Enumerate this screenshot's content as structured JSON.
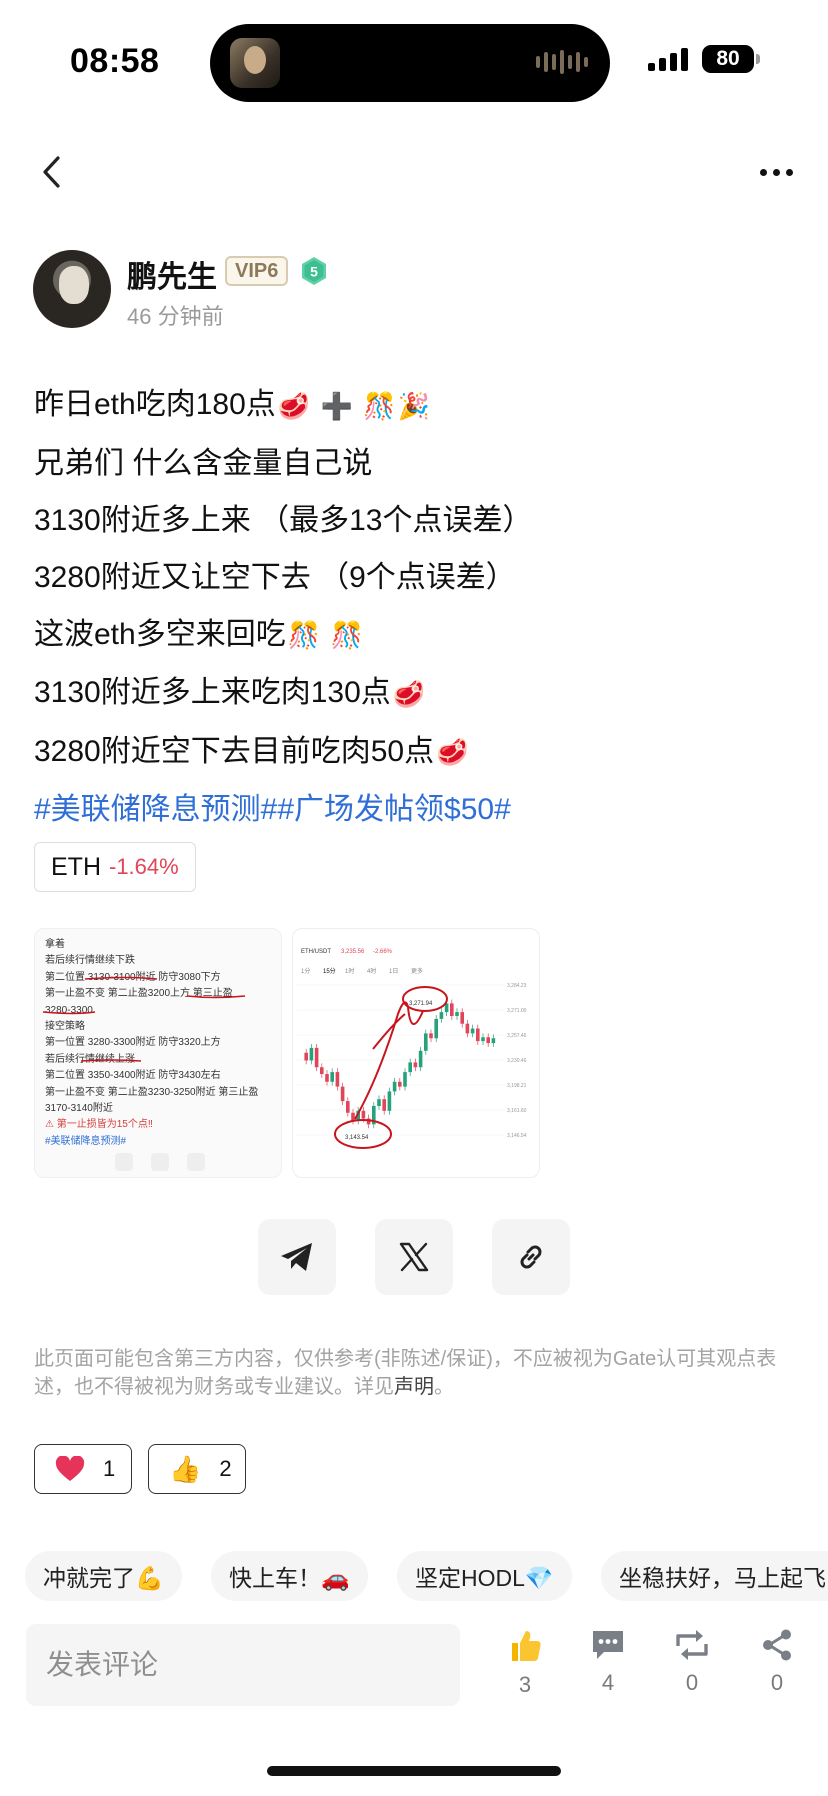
{
  "status_bar": {
    "time": "08:58",
    "battery": "80"
  },
  "author": {
    "name": "鹏先生",
    "vip": "VIP6",
    "level": "5",
    "time_ago": "46 分钟前"
  },
  "post": {
    "lines": [
      "昨日eth吃肉180点",
      "兄弟们 什么含金量自己说",
      "3130附近多上来 （最多13个点误差）",
      "3280附近又让空下去 （9个点误差）",
      "这波eth多空来回吃",
      "3130附近多上来吃肉130点",
      "3280附近空下去目前吃肉50点"
    ],
    "tags": "#美联储降息预测##广场发帖领$50#"
  },
  "ticker": {
    "symbol": "ETH",
    "change": "-1.64%"
  },
  "image_note": {
    "lines": [
      "拿着",
      "若后续行情继续下跌",
      "第二位置 3130-3100附近 防守3080下方",
      "第一止盈不变 第二止盈3200上方 第三止盈",
      "3280-3300",
      "接空策略",
      "第一位置 3280-3300附近 防守3320上方",
      "若后续行情继续上涨",
      "第二位置 3350-3400附近 防守3430左右",
      "第一止盈不变 第二止盈3230-3250附近 第三止盈",
      "3170-3140附近"
    ],
    "warning": "⚠ 第一止损皆为15个点‼",
    "tag": "#美联储降息预测#"
  },
  "image_chart": {
    "pair": "ETH/USDT",
    "price": "3,235.56",
    "change": "-2.66%",
    "intervals": [
      "1分",
      "15分",
      "1时",
      "4时",
      "1日",
      "更多"
    ],
    "high_label": "3,271.94",
    "low_label": "3,143.54",
    "right_labels": [
      "3,284.23",
      "3,271.00",
      "3,257.46",
      "3,230.46",
      "3,198.21",
      "3,161.60",
      "3,146.54"
    ],
    "annotation_color": "#c8151d"
  },
  "share_buttons": [
    "telegram-icon",
    "x-icon",
    "link-icon"
  ],
  "disclaimer": {
    "text": "此页面可能包含第三方内容，仅供参考(非陈述/保证)，不应被视为Gate认可其观点表述，也不得被视为财务或专业建议。详见",
    "link": "声明",
    "end": "。"
  },
  "reactions": [
    {
      "icon": "heart-icon",
      "count": "1"
    },
    {
      "icon": "thumbs-up-icon",
      "count": "2"
    }
  ],
  "quick_replies": [
    "冲就完了💪",
    "快上车！🚗",
    "坚定HODL💎",
    "坐稳扶好，马上起飞"
  ],
  "comment": {
    "placeholder": "发表评论"
  },
  "actions": [
    {
      "icon": "like-icon",
      "count": "3"
    },
    {
      "icon": "comment-icon",
      "count": "4"
    },
    {
      "icon": "repost-icon",
      "count": "0"
    },
    {
      "icon": "share-icon",
      "count": "0"
    }
  ],
  "colors": {
    "tag_blue": "#2f6fd6",
    "down_red": "#e0455a",
    "candle_up": "#26a17b",
    "candle_down": "#e0455a"
  }
}
